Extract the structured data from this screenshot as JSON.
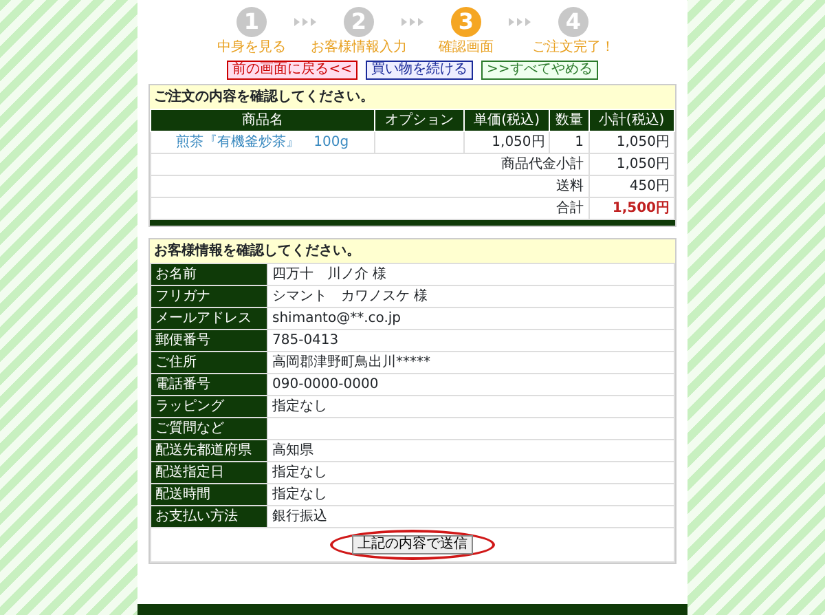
{
  "steps": [
    {
      "number": "1",
      "label": "中身を見る",
      "selected": false
    },
    {
      "number": "2",
      "label": "お客様情報入力",
      "selected": false
    },
    {
      "number": "3",
      "label": "確認画面",
      "selected": true
    },
    {
      "number": "4",
      "label": "ご注文完了！",
      "selected": false
    }
  ],
  "nav_buttons": [
    {
      "label": "前の画面に戻る<<",
      "kind": "back"
    },
    {
      "label": "買い物を続ける",
      "kind": "continue"
    },
    {
      "label": ">>すべてやめる",
      "kind": "cancel"
    }
  ],
  "order": {
    "title": "ご注文の内容を確認してください。",
    "columns": [
      "商品名",
      "オプション",
      "単価(税込)",
      "数量",
      "小計(税込)"
    ],
    "rows": [
      {
        "product": "煎茶『有機釜炒茶』　100g",
        "option": "",
        "price": "1,050円",
        "qty": "1",
        "subtotal": "1,050円"
      }
    ],
    "summary": [
      {
        "label": "商品代金小計",
        "value": "1,050円",
        "kind": "normal"
      },
      {
        "label": "送料",
        "value": "450円",
        "kind": "normal"
      },
      {
        "label": "合計",
        "value": "1,500円",
        "kind": "total"
      }
    ]
  },
  "customer": {
    "title": "お客様情報を確認してください。",
    "rows": [
      {
        "label": "お名前",
        "value": "四万十　川ノ介 様"
      },
      {
        "label": "フリガナ",
        "value": "シマント　カワノスケ 様"
      },
      {
        "label": "メールアドレス",
        "value": "shimanto@**.co.jp"
      },
      {
        "label": "郵便番号",
        "value": "785-0413"
      },
      {
        "label": "ご住所",
        "value": "高岡郡津野町鳥出川*****"
      },
      {
        "label": "電話番号",
        "value": "090-0000-0000"
      },
      {
        "label": "ラッピング",
        "value": "指定なし"
      },
      {
        "label": "ご質問など",
        "value": ""
      },
      {
        "label": "配送先都道府県",
        "value": "高知県"
      },
      {
        "label": "配送指定日",
        "value": "指定なし"
      },
      {
        "label": "配送時間",
        "value": "指定なし"
      },
      {
        "label": "お支払い方法",
        "value": "銀行振込"
      }
    ],
    "submit": {
      "label": "上記の内容で送信",
      "highlighted": true
    }
  }
}
